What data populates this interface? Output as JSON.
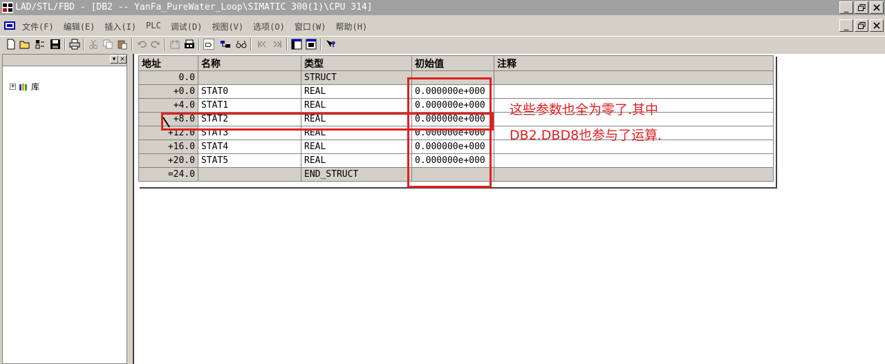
{
  "window": {
    "title": "LAD/STL/FBD  - [DB2 -- YanFa_PureWater_Loop\\SIMATIC 300(1)\\CPU 314]",
    "controls": [
      "_",
      "̸",
      "X"
    ]
  },
  "menu": {
    "items": [
      "文件(F)",
      "编辑(E)",
      "插入(I)",
      "PLC",
      "调试(D)",
      "视图(V)",
      "选项(O)",
      "窗口(W)",
      "帮助(H)"
    ]
  },
  "toolbar": {
    "icons": [
      "new-icon",
      "open-icon",
      "accessible-nodes-icon",
      "save-icon",
      "print-icon",
      "cut-icon",
      "copy-icon",
      "paste-icon",
      "undo-icon",
      "redo-icon",
      "load-icon",
      "monitor-icon",
      "declaration-view-icon",
      "data-view-icon",
      "glasses-icon",
      "breakpoint-icon",
      "overview-icon",
      "zoom-icon",
      "help-icon"
    ]
  },
  "tree": {
    "item_label": "库"
  },
  "table": {
    "headers": {
      "address": "地址",
      "name": "名称",
      "type": "类型",
      "initial": "初始值",
      "comment": "注释"
    },
    "rows": [
      {
        "address": "0.0",
        "name": "",
        "type": "STRUCT",
        "initial": "",
        "comment": ""
      },
      {
        "address": "+0.0",
        "name": "STAT0",
        "type": "REAL",
        "initial": "0.000000e+000",
        "comment": ""
      },
      {
        "address": "+4.0",
        "name": "STAT1",
        "type": "REAL",
        "initial": "0.000000e+000",
        "comment": ""
      },
      {
        "address": "+8.0",
        "name": "STAT2",
        "type": "REAL",
        "initial": "0.000000e+000",
        "comment": ""
      },
      {
        "address": "+12.0",
        "name": "STAT3",
        "type": "REAL",
        "initial": "0.000000e+000",
        "comment": ""
      },
      {
        "address": "+16.0",
        "name": "STAT4",
        "type": "REAL",
        "initial": "0.000000e+000",
        "comment": ""
      },
      {
        "address": "+20.0",
        "name": "STAT5",
        "type": "REAL",
        "initial": "0.000000e+000",
        "comment": ""
      },
      {
        "address": "=24.0",
        "name": "",
        "type": "END_STRUCT",
        "initial": "",
        "comment": ""
      }
    ]
  },
  "annotation": {
    "line1": "这些参数也全为零了.其中",
    "line2": "DB2.DBD8也参与了运算.",
    "color": "#e02020"
  }
}
